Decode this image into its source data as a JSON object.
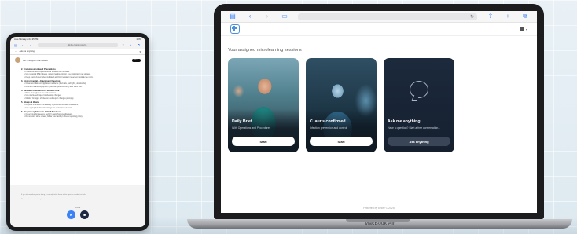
{
  "ipad": {
    "status": {
      "time": "June Monday at 10:25 PM",
      "battery": "100%"
    },
    "url": "kinlife.chatgpt.com/c/...",
    "appbar": {
      "title": "Ask me anything"
    },
    "chat_header": {
      "name": "Kin - Support the Coach",
      "new_button": "New"
    },
    "sections": [
      {
        "heading": "2. Transmission-Based Precautions",
        "lines": [
          "Follow contact/droplet/airborne isolation as indicated.",
          "Use required PPE (gloves, gown, mask/respirator, eye protection) per signage.",
          "Keep doors closed when indicated and limit resident movement outside the room."
        ]
      },
      {
        "heading": "3. Environmental & Equipment Cleaning",
        "lines": [
          "Clean and disinfect high-touch surfaces (bed rails, call lights, doorknobs).",
          "Disinfect shared equipment (stethoscopes, BP cuffs) after each use."
        ]
      },
      {
        "heading": "4. Resident Assessment & Wound Care",
        "lines": [
          "Wear clean gloves for each resident.",
          "Use sterile technique for dressing changes.",
          "Monitor for signs of infection and report changes promptly."
        ]
      },
      {
        "heading": "5. Sharps & Waste",
        "lines": [
          "Dispose of sharps immediately in puncture-resistant containers.",
          "Use appropriate biohazard bags for contaminated waste."
        ]
      },
      {
        "heading": "6. Respiratory Etiquette & Staff Practices",
        "lines": [
          "Cover coughs/sneezes, perform hand hygiene afterward.",
          "Do not work while unwell; follow your facility's illness reporting policy."
        ]
      }
    ],
    "closing": "If you tell me what you're doing, I can help tailor these to the specific resident or task.",
    "footer_note": "AI-generated content may be incorrect",
    "controls_label": "Kinlife"
  },
  "mac": {
    "label": "MacBook Air",
    "language": "EN",
    "heading": "Your assigned microlearning sessions",
    "cards": [
      {
        "title": "Daily Brief",
        "subtitle": "With Operations and Procedures",
        "button": "Start"
      },
      {
        "title": "C. auris confirmed",
        "subtitle": "Infection prevention and control",
        "button": "Start"
      },
      {
        "title": "Ask me anything",
        "subtitle": "Have a question? Start a free conversation...",
        "button": "Ask anything"
      }
    ],
    "footer": "Powered by kinlife  © 2025"
  }
}
